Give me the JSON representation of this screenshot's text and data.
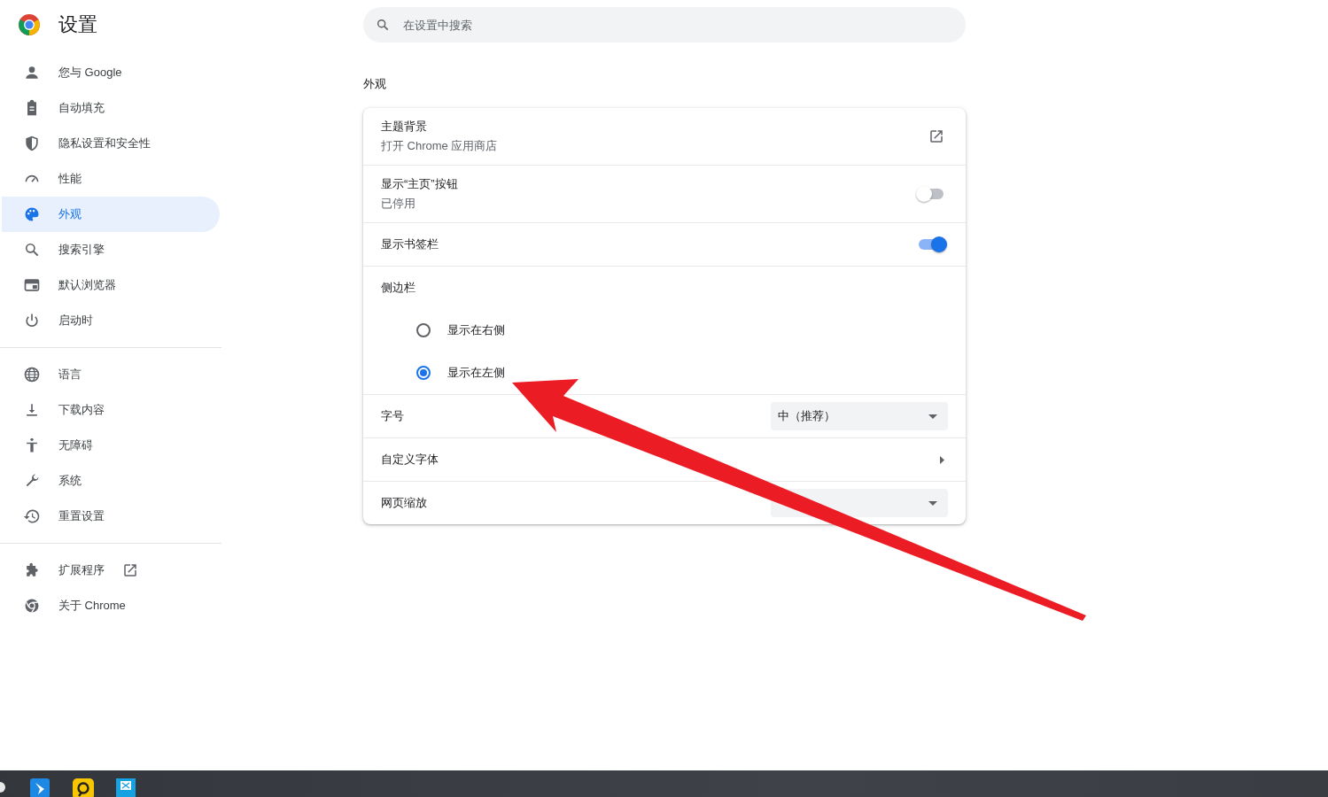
{
  "header": {
    "title": "设置"
  },
  "search": {
    "placeholder": "在设置中搜索"
  },
  "sidebar": {
    "groups": [
      {
        "items": [
          {
            "label": "您与 Google",
            "selected": false
          },
          {
            "label": "自动填充",
            "selected": false
          },
          {
            "label": "隐私设置和安全性",
            "selected": false
          },
          {
            "label": "性能",
            "selected": false
          },
          {
            "label": "外观",
            "selected": true
          },
          {
            "label": "搜索引擎",
            "selected": false
          },
          {
            "label": "默认浏览器",
            "selected": false
          },
          {
            "label": "启动时",
            "selected": false
          }
        ]
      },
      {
        "items": [
          {
            "label": "语言",
            "selected": false
          },
          {
            "label": "下载内容",
            "selected": false
          },
          {
            "label": "无障碍",
            "selected": false
          },
          {
            "label": "系统",
            "selected": false
          },
          {
            "label": "重置设置",
            "selected": false
          }
        ]
      },
      {
        "items": [
          {
            "label": "扩展程序",
            "selected": false,
            "kind": "external"
          },
          {
            "label": "关于 Chrome",
            "selected": false
          }
        ]
      }
    ]
  },
  "section": {
    "title": "外观",
    "rows": [
      {
        "kind": "link",
        "title": "主题背景",
        "subtitle": "打开 Chrome 应用商店"
      },
      {
        "kind": "toggle",
        "title": "显示“主页”按钮",
        "subtitle": "已停用",
        "on": false
      },
      {
        "kind": "toggle",
        "title": "显示书签栏",
        "on": true
      },
      {
        "kind": "radio_group",
        "title": "侧边栏",
        "options": [
          {
            "label": "显示在右侧",
            "selected": false
          },
          {
            "label": "显示在左侧",
            "selected": true
          }
        ]
      },
      {
        "kind": "dropdown",
        "title": "字号",
        "value": "中（推荐）"
      },
      {
        "kind": "submenu",
        "title": "自定义字体"
      },
      {
        "kind": "dropdown",
        "title": "网页缩放"
      }
    ]
  },
  "annotation": {
    "kind": "arrow"
  },
  "taskbar": {
    "apps": [
      {
        "kind": "partial"
      },
      {
        "kind": "blue"
      },
      {
        "kind": "yellow"
      },
      {
        "kind": "cyan"
      }
    ]
  }
}
